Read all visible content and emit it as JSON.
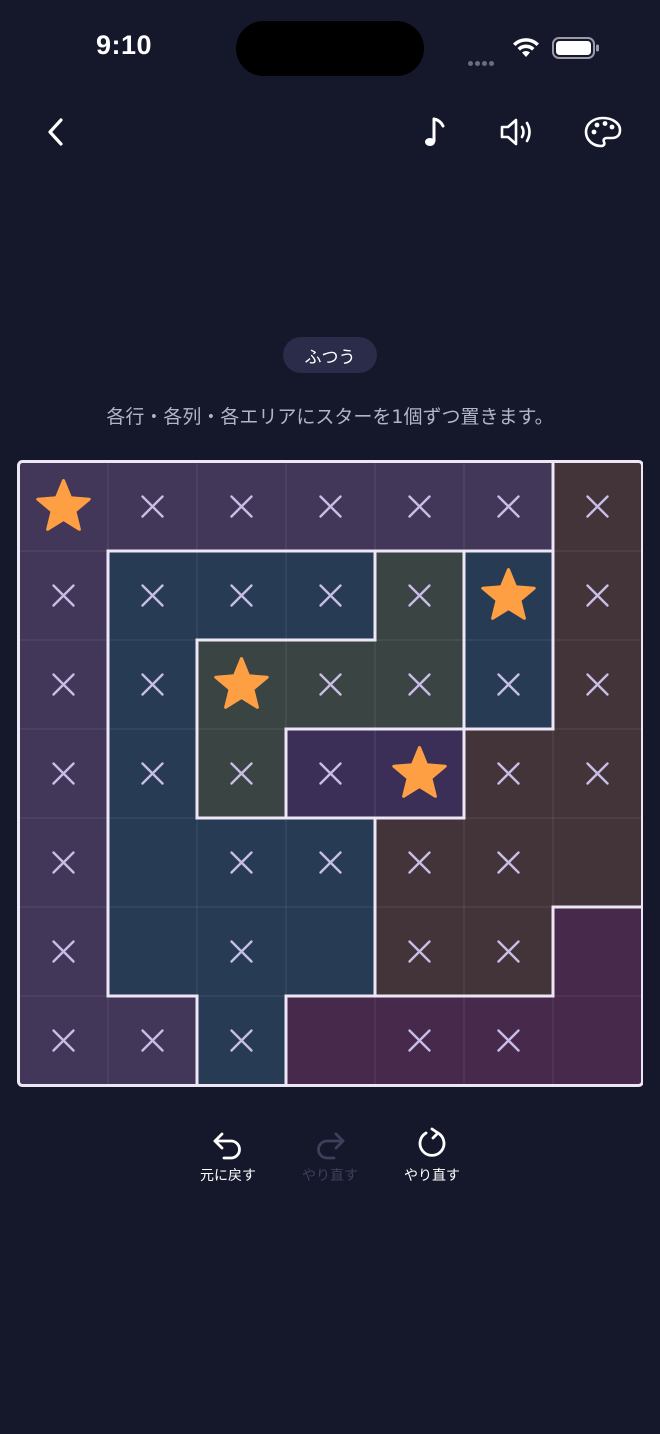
{
  "status": {
    "time": "9:10"
  },
  "header": {
    "back_icon": "chevron-left-icon",
    "music_icon": "music-note-icon",
    "sound_icon": "speaker-icon",
    "theme_icon": "palette-icon"
  },
  "difficulty": "ふつう",
  "instruction": "各行・各列・各エリアにスターを1個ずつ置きます。",
  "puzzle": {
    "size": 7,
    "regions": [
      [
        "A",
        "A",
        "A",
        "A",
        "A",
        "A",
        "B"
      ],
      [
        "A",
        "C",
        "C",
        "C",
        "D",
        "C",
        "B"
      ],
      [
        "A",
        "C",
        "D",
        "D",
        "D",
        "C",
        "B"
      ],
      [
        "A",
        "C",
        "D",
        "E",
        "E",
        "B",
        "B"
      ],
      [
        "A",
        "C",
        "C",
        "C",
        "B",
        "B",
        "B"
      ],
      [
        "A",
        "C",
        "C",
        "C",
        "B",
        "B",
        "F"
      ],
      [
        "A",
        "A",
        "C",
        "F",
        "F",
        "F",
        "F"
      ]
    ],
    "region_colors": {
      "A": "#433759",
      "B": "#433439",
      "C": "#283b55",
      "D": "#3a4443",
      "E": "#3b2f58",
      "F": "#472a4b"
    },
    "cells": [
      [
        "star",
        "x",
        "x",
        "x",
        "x",
        "x",
        "x"
      ],
      [
        "x",
        "x",
        "x",
        "x",
        "x",
        "star",
        "x"
      ],
      [
        "x",
        "x",
        "star",
        "x",
        "x",
        "x",
        "x"
      ],
      [
        "x",
        "x",
        "x",
        "x",
        "star",
        "x",
        "x"
      ],
      [
        "x",
        "",
        "x",
        "x",
        "x",
        "x",
        ""
      ],
      [
        "x",
        "",
        "x",
        "",
        "x",
        "x",
        ""
      ],
      [
        "x",
        "x",
        "x",
        "",
        "x",
        "x",
        ""
      ]
    ],
    "star_color": "#ff9f43",
    "mark_color": "#c7bde6",
    "border_color": "#ece6f5"
  },
  "controls": {
    "undo": {
      "label": "元に戻す",
      "icon": "undo-icon",
      "enabled": true
    },
    "redo": {
      "label": "やり直す",
      "icon": "redo-icon",
      "enabled": false
    },
    "reset": {
      "label": "やり直す",
      "icon": "reset-icon",
      "enabled": true
    }
  }
}
